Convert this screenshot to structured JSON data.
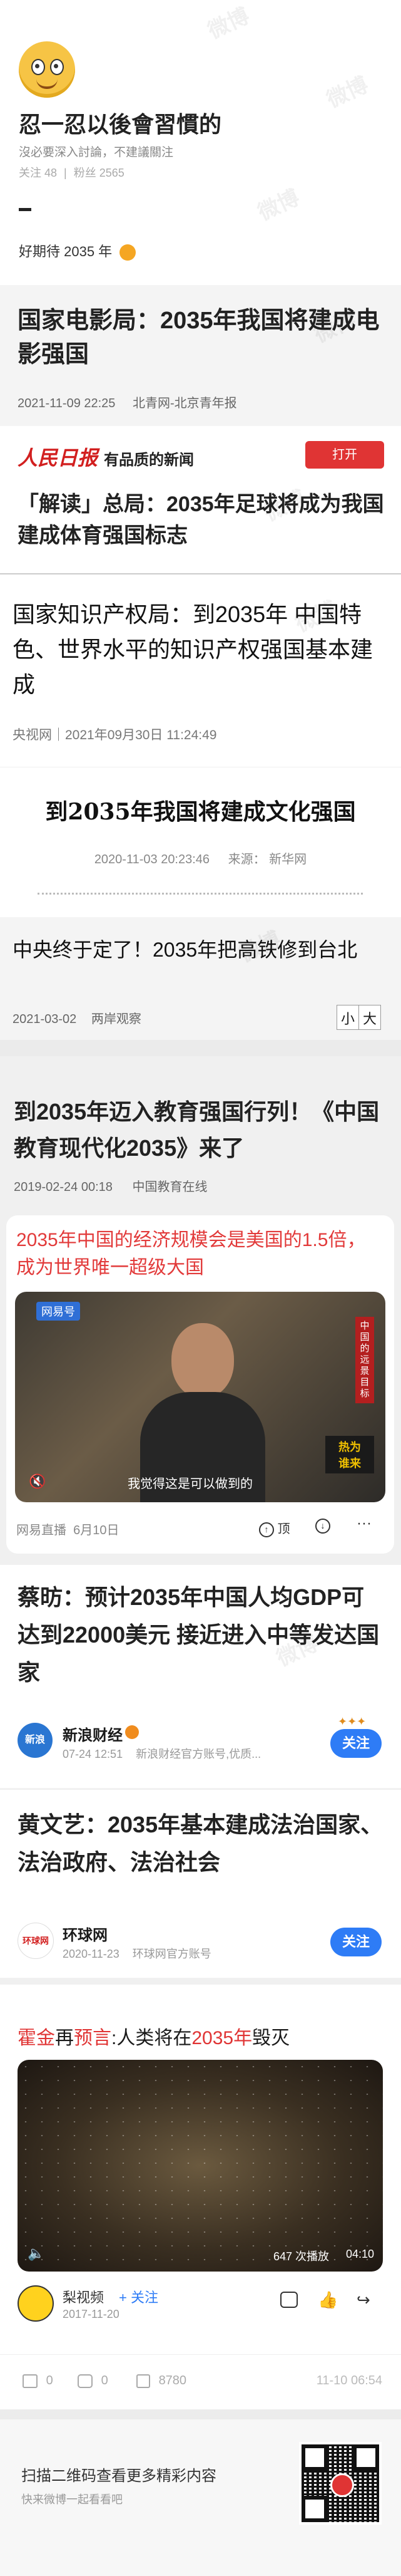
{
  "profile": {
    "name": "忍一忍以後會習慣的",
    "bio": "沒必要深入討論，不建議關注",
    "follow_label": "关注 48",
    "fans_label": "粉丝 2565",
    "post_text": "好期待 2035 年"
  },
  "articles": [
    {
      "title": "国家电影局：2035年我国将建成电影强国",
      "date": "2021-11-09 22:25",
      "source": "北青网-北京青年报"
    },
    {
      "brand": "人民日报",
      "slogan": "有品质的新闻",
      "open_label": "打开",
      "title": "「解读」总局：2035年足球将成为我国建成体育强国标志"
    },
    {
      "title": "国家知识产权局：到2035年 中国特色、世界水平的知识产权强国基本建成",
      "meta": "央视网｜2021年09月30日 11:24:49"
    },
    {
      "title": "到2035年我国将建成文化强国",
      "date": "2020-11-03 20:23:46",
      "source": "来源： 新华网"
    },
    {
      "title": "中央终于定了！2035年把高铁修到台北",
      "date": "2021-03-02",
      "source": "两岸观察",
      "font_small": "小",
      "font_big": "大"
    },
    {
      "title": "到2035年迈入教育强国行列！《中国教育现代化2035》来了",
      "date": "2019-02-24 00:18",
      "source": "中国教育在线"
    }
  ],
  "video_card": {
    "headline": "2035年中国的经济规模会是美国的1.5倍，成为世界唯一超级大国",
    "badge": "网易号",
    "caption": "我觉得这是可以做到的",
    "side_label": "中国的远景目标",
    "tag": "热为\n谁来",
    "footer_left": "网易直播  6月10日",
    "up_label": "顶"
  },
  "weibo_posts": [
    {
      "title": "蔡昉：预计2035年中国人均GDP可达到22000美元 接近进入中等发达国家",
      "user": "新浪财经",
      "time": "07-24 12:51",
      "desc": "新浪财经官方账号,优质...",
      "follow_label": "关注",
      "avatar_text": "新浪"
    },
    {
      "title": "黄文艺：2035年基本建成法治国家、法治政府、法治社会",
      "user": "环球网",
      "time": "2020-11-23",
      "desc": "环球网官方账号",
      "follow_label": "关注",
      "avatar_text": "环球网"
    }
  ],
  "final_post": {
    "headline_a": "霍金",
    "headline_b": "再",
    "headline_c": "预言",
    "headline_d": ":人类将在",
    "headline_e": "2035年",
    "headline_f": "毁灭",
    "views": "647 次播放",
    "duration": "04:10",
    "user": "梨视频",
    "follow_label": "+ 关注",
    "date": "2017-11-20"
  },
  "stats": {
    "reposts": "0",
    "comments": "0",
    "likes": "8780",
    "timestamp": "11-10 06:54"
  },
  "footer": {
    "line1": "扫描二维码查看更多精彩内容",
    "line2": "快来微博一起看看吧"
  },
  "colors": {
    "accent_blue": "#2e7cf6",
    "red": "#e03434",
    "orange": "#f08c1e"
  }
}
